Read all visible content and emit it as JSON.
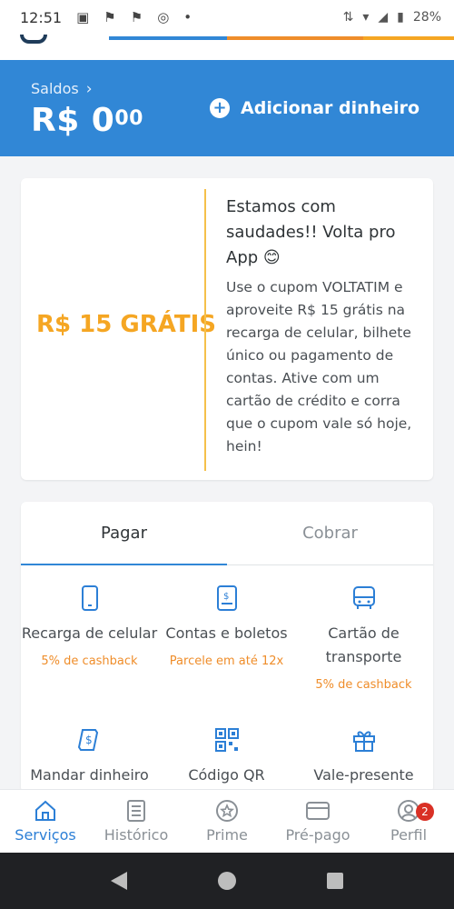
{
  "status_bar": {
    "time": "12:51",
    "battery": "28%",
    "icons": [
      "image-icon",
      "flag-icon",
      "flag-icon",
      "instagram-icon",
      "dot-icon",
      "data-icon",
      "wifi-icon",
      "signal-icon",
      "battery-icon"
    ]
  },
  "header": {
    "balance_label": "Saldos",
    "balance_int": "R$ 0",
    "balance_cents": "00",
    "add_money_label": "Adicionar dinheiro"
  },
  "promo": {
    "price": "R$ 15 GRÁTIS",
    "title": "Estamos com saudades!! Volta pro App 😊",
    "body": "Use o cupom VOLTATIM e aproveite R$ 15 grátis na recarga de celular, bilhete único ou pagamento de contas. Ative com um cartão de crédito e corra que o cupom vale só hoje, hein!"
  },
  "tabs": {
    "pay": "Pagar",
    "charge": "Cobrar"
  },
  "services": [
    {
      "name": "Recarga de celular",
      "sub": "5% de cashback",
      "icon": "phone-icon"
    },
    {
      "name": "Contas e boletos",
      "sub": "Parcele em até 12x",
      "icon": "bill-icon"
    },
    {
      "name": "Cartão de transporte",
      "sub": "5% de cashback",
      "icon": "bus-icon"
    },
    {
      "name": "Mandar dinheiro",
      "sub": "",
      "icon": "money-transfer-icon"
    },
    {
      "name": "Código QR",
      "sub": "",
      "icon": "qr-code-icon"
    },
    {
      "name": "Vale-presente",
      "sub": "",
      "icon": "gift-icon"
    }
  ],
  "bottom_nav": [
    {
      "label": "Serviços",
      "icon": "home-icon"
    },
    {
      "label": "Histórico",
      "icon": "history-icon"
    },
    {
      "label": "Prime",
      "icon": "prime-star-icon"
    },
    {
      "label": "Pré-pago",
      "icon": "card-icon"
    },
    {
      "label": "Perfil",
      "icon": "profile-icon",
      "badge": "2"
    }
  ],
  "colors": {
    "primary": "#3187d6",
    "accent_orange": "#f5a623",
    "cashback_orange": "#ef8d2a",
    "badge_red": "#d93025"
  }
}
